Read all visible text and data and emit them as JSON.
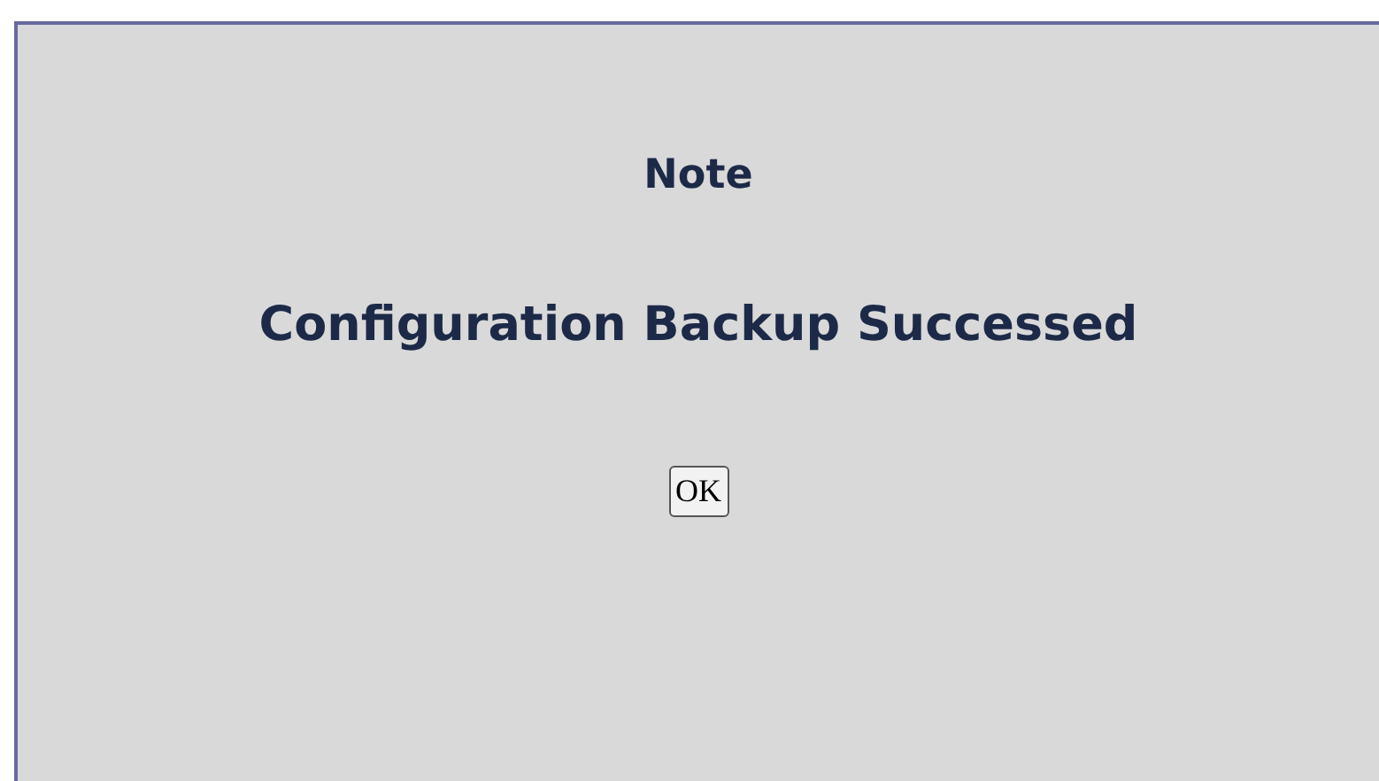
{
  "title": "Note",
  "message": "Configuration Backup Successed",
  "buttons": [
    "OK"
  ]
}
